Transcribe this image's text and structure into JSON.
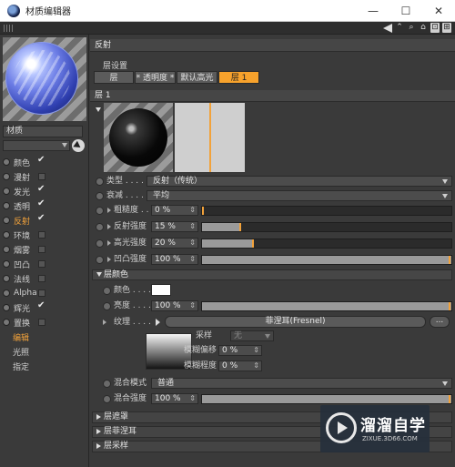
{
  "window": {
    "title": "材质编辑器",
    "buttons": {
      "minimize": "—",
      "maximize": "☐",
      "close": "✕"
    }
  },
  "toolbar": {
    "nav": {
      "back": "back-arrow-icon",
      "up": "up-arrow-icon",
      "search": "search-icon",
      "lock": "lock-icon",
      "expand": "expand-icon",
      "new": "new-panel-icon"
    }
  },
  "material": {
    "name": "材质",
    "preview_icon": "material-sphere-preview"
  },
  "channels": [
    {
      "label": "颜色",
      "checked": true
    },
    {
      "label": "漫射",
      "checked": false
    },
    {
      "label": "发光",
      "checked": true
    },
    {
      "label": "透明",
      "checked": true
    },
    {
      "label": "反射",
      "checked": true,
      "active": true
    },
    {
      "label": "环境",
      "checked": false
    },
    {
      "label": "烟雾",
      "checked": false
    },
    {
      "label": "凹凸",
      "checked": false
    },
    {
      "label": "法线",
      "checked": false
    },
    {
      "label": "Alpha",
      "checked": false
    },
    {
      "label": "辉光",
      "checked": true
    },
    {
      "label": "置换",
      "checked": false
    }
  ],
  "extra_items": [
    {
      "label": "编辑",
      "active": true
    },
    {
      "label": "光照"
    },
    {
      "label": "指定"
    }
  ],
  "reflection": {
    "header": "反射",
    "layer_settings": "层设置",
    "tabs": [
      "层",
      "* 透明度 *",
      "默认高光",
      "层 1"
    ],
    "active_tab": "层 1",
    "layer_header": "层 1",
    "props": {
      "type": {
        "label": "类型 . . . . .",
        "value": "反射（传统）"
      },
      "falloff": {
        "label": "衰减 . . . . .",
        "value": "平均"
      },
      "roughness": {
        "label": "粗糙度 . . .",
        "value": "0 %",
        "fraction": 0.0
      },
      "reflect_strength": {
        "label": "反射强度",
        "value": "15 %",
        "fraction": 0.15
      },
      "spec_strength": {
        "label": "高光强度",
        "value": "20 %",
        "fraction": 0.2
      },
      "bump_strength": {
        "label": "凹凸强度",
        "value": "100 %",
        "fraction": 1.0
      }
    },
    "layer_color": {
      "header": "层颜色",
      "color_label": "颜色 . . . .",
      "color_value": "#ffffff",
      "brightness": {
        "label": "亮度 . . . .",
        "value": "100 %",
        "fraction": 1.0
      },
      "texture": {
        "label": "纹理 . . . .",
        "shader": "菲涅耳(Fresnel)",
        "more": "..."
      },
      "sampling": {
        "label": "采样",
        "value": "无"
      },
      "blur_offset": {
        "label": "模糊偏移",
        "value": "0 %"
      },
      "blur_degree": {
        "label": "模糊程度",
        "value": "0 %"
      },
      "blend_mode": {
        "label": "混合模式",
        "value": "普通"
      },
      "blend_strength": {
        "label": "混合强度",
        "value": "100 %",
        "fraction": 1.0
      }
    },
    "folds": [
      "层遮罩",
      "层菲涅耳",
      "层采样"
    ]
  },
  "watermark": {
    "brand": "溜溜自学",
    "url": "ZIXUE.3D66.COM"
  }
}
